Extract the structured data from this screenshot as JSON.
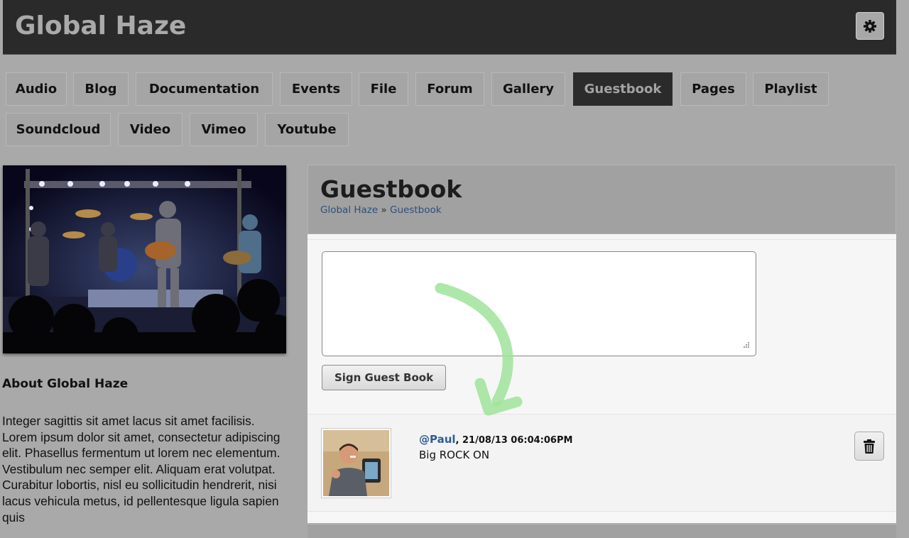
{
  "site": {
    "title": "Global Haze"
  },
  "header": {
    "settings_icon": "gear-icon"
  },
  "nav": {
    "row1": [
      {
        "label": "Audio"
      },
      {
        "label": "Blog"
      },
      {
        "label": "Documentation"
      },
      {
        "label": "Events"
      },
      {
        "label": "File"
      },
      {
        "label": "Forum"
      },
      {
        "label": "Gallery"
      },
      {
        "label": "Guestbook",
        "active": true
      },
      {
        "label": "Pages"
      },
      {
        "label": "Playlist"
      }
    ],
    "row2": [
      {
        "label": "Soundcloud"
      },
      {
        "label": "Video"
      },
      {
        "label": "Vimeo"
      },
      {
        "label": "Youtube"
      }
    ],
    "active_color": "#2b2b2b"
  },
  "sidebar": {
    "about_heading": "About Global Haze",
    "about_text": "Integer sagittis sit amet lacus sit amet facilisis. Lorem ipsum dolor sit amet, consectetur adipiscing elit. Phasellus fermentum ut lorem nec elementum. Vestibulum nec semper elit. Aliquam erat volutpat. Curabitur lobortis, nisl eu sollicitudin hendrerit, nisi lacus vehicula metus, id pellentesque ligula sapien quis"
  },
  "main": {
    "title": "Guestbook",
    "breadcrumb": {
      "home": "Global Haze",
      "separator": "»",
      "current": "Guestbook"
    },
    "form": {
      "message_value": "",
      "sign_button_label": "Sign Guest Book"
    },
    "entries": [
      {
        "author": "@Paul",
        "timestamp": ", 21/08/13 06:04:06PM",
        "message": "Big ROCK ON",
        "delete_icon": "trash-icon"
      }
    ]
  },
  "colors": {
    "link": "#2d5d93",
    "header_bg": "#2a2a2a",
    "annotation_arrow": "#9fe39a"
  }
}
